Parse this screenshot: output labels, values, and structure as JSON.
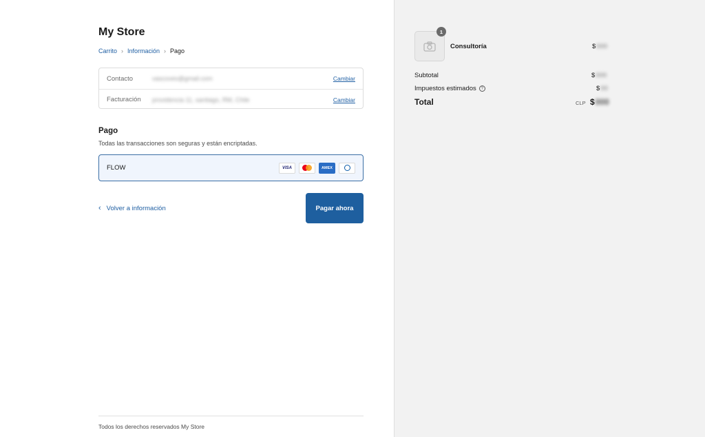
{
  "store": {
    "name": "My Store"
  },
  "breadcrumb": {
    "items": [
      "Carrito",
      "Información"
    ],
    "current": "Pago"
  },
  "review": {
    "contact_label": "Contacto",
    "contact_value": "vascoves@gmail.com",
    "billing_label": "Facturación",
    "billing_value": "providencia 11, santiago, RM, Chile",
    "change_label": "Cambiar"
  },
  "payment": {
    "title": "Pago",
    "subtitle": "Todas las transacciones son seguras y están encriptadas.",
    "method_name": "FLOW",
    "cards": [
      "VISA",
      "mastercard",
      "AMEX",
      "diners"
    ]
  },
  "actions": {
    "back_label": "Volver a información",
    "pay_label": "Pagar ahora"
  },
  "footer": {
    "text": "Todos los derechos reservados My Store"
  },
  "summary": {
    "quantity": "1",
    "product_name": "Consultoría",
    "product_price_symbol": "$",
    "product_price_hidden": "000",
    "subtotal_label": "Subtotal",
    "subtotal_symbol": "$",
    "subtotal_hidden": "000",
    "tax_label": "Impuestos estimados",
    "tax_symbol": "$",
    "tax_hidden": "00",
    "total_label": "Total",
    "currency": "CLP",
    "total_symbol": "$",
    "total_hidden": "000"
  },
  "colors": {
    "accent": "#1e5f9f",
    "link": "#1f5fa3",
    "sidebar_bg": "#f2f2f2"
  }
}
